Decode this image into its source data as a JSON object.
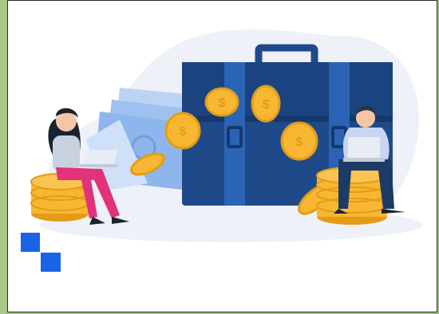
{
  "scene": {
    "colors": {
      "page_bg": "#a9c98a",
      "frame_bg": "#ffffff",
      "blob": "#eef1f8",
      "briefcase": "#1f4a8a",
      "briefcase_dark": "#16386b",
      "briefcase_light": "#2b63b5",
      "coin": "#f7b733",
      "coin_dark": "#e39c18",
      "money": "#9ec1ef",
      "money_dark": "#6f9fe0",
      "woman_pants": "#e0337a",
      "woman_top": "#c9d0de",
      "hair": "#1a2330",
      "man_shirt": "#c7d5f2",
      "man_pants": "#1e3a66",
      "skin": "#f3c6a6",
      "accent_square": "#1a63e6"
    },
    "elements": {
      "briefcase": "briefcase-icon",
      "coins": "coin-icon",
      "banknotes": "money-icon",
      "woman": "person-icon",
      "man": "person-icon",
      "laptops": "laptop-icon",
      "squares": "square-icon"
    }
  }
}
